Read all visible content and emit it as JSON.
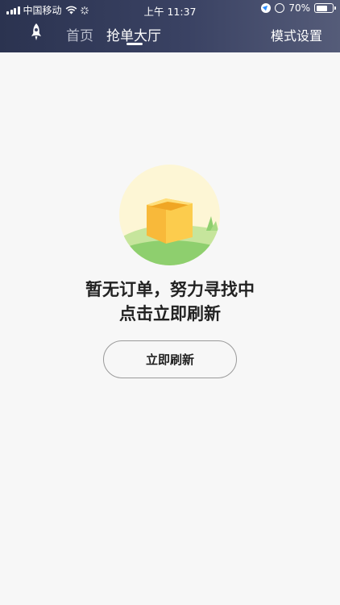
{
  "status_bar": {
    "carrier": "中国移动",
    "time": "上午 11:37",
    "battery": "70%",
    "battery_level": 0.7
  },
  "header": {
    "tabs": [
      {
        "label": "首页",
        "active": false
      },
      {
        "label": "抢单大厅",
        "active": true
      }
    ],
    "mode_settings": "模式设置",
    "logo_icon": "rocket-icon"
  },
  "empty_state": {
    "line1": "暂无订单，努力寻找中",
    "line2": "点击立即刷新",
    "button": "立即刷新",
    "illustration": "empty-box-illustration"
  },
  "colors": {
    "header_start": "#2b3350",
    "header_end": "#555c79",
    "background": "#f7f7f7",
    "box": "#f8b93a"
  }
}
